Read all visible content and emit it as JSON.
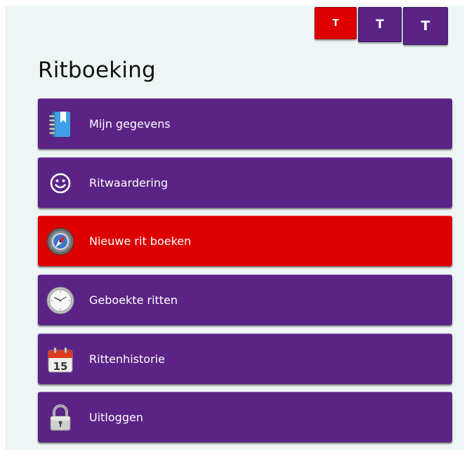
{
  "title": "Ritboeking",
  "text_size_buttons": [
    {
      "label": "T",
      "active": true
    },
    {
      "label": "T",
      "active": false
    },
    {
      "label": "T",
      "active": false
    }
  ],
  "menu": [
    {
      "label": "Mijn gegevens",
      "icon": "address-book-icon",
      "active": false
    },
    {
      "label": "Ritwaardering",
      "icon": "smiley-icon",
      "active": false
    },
    {
      "label": "Nieuwe rit boeken",
      "icon": "compass-icon",
      "active": true
    },
    {
      "label": "Geboekte ritten",
      "icon": "clock-icon",
      "active": false
    },
    {
      "label": "Rittenhistorie",
      "icon": "calendar-icon",
      "active": false,
      "icon_text": "15"
    },
    {
      "label": "Uitloggen",
      "icon": "padlock-icon",
      "active": false
    }
  ],
  "colors": {
    "menu_background": "#5a2385",
    "active_background": "#dd0000",
    "panel_background": "#eef5f5",
    "text_on_button": "#ffffff"
  }
}
